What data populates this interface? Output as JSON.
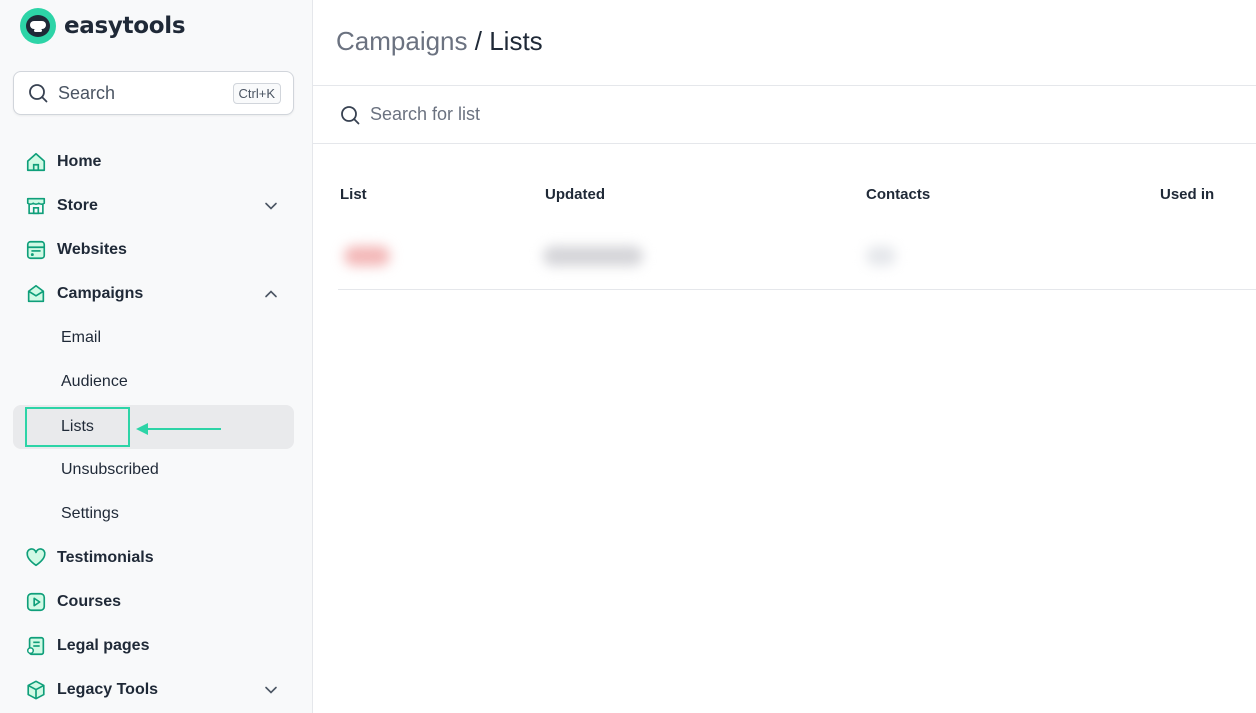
{
  "app": {
    "name": "easytools",
    "brand_color": "#2dd4a7"
  },
  "sidebar": {
    "search": {
      "label": "Search",
      "shortcut": "Ctrl+K",
      "icon": "search-icon"
    },
    "items": [
      {
        "label": "Home",
        "icon": "home-icon"
      },
      {
        "label": "Store",
        "icon": "store-icon",
        "expandable": true,
        "expanded": false
      },
      {
        "label": "Websites",
        "icon": "websites-icon"
      },
      {
        "label": "Campaigns",
        "icon": "campaigns-icon",
        "expandable": true,
        "expanded": true,
        "children": [
          {
            "label": "Email"
          },
          {
            "label": "Audience"
          },
          {
            "label": "Lists",
            "active": true
          },
          {
            "label": "Unsubscribed"
          },
          {
            "label": "Settings"
          }
        ]
      },
      {
        "label": "Testimonials",
        "icon": "heart-icon"
      },
      {
        "label": "Courses",
        "icon": "play-icon"
      },
      {
        "label": "Legal pages",
        "icon": "legal-icon"
      },
      {
        "label": "Legacy Tools",
        "icon": "box-icon",
        "expandable": true,
        "expanded": false
      }
    ]
  },
  "header": {
    "breadcrumb_parent": "Campaigns",
    "separator": "/",
    "breadcrumb_current": "Lists"
  },
  "list_search": {
    "placeholder": "Search for list"
  },
  "table": {
    "columns": [
      "List",
      "Updated",
      "Contacts",
      "Used in"
    ]
  }
}
